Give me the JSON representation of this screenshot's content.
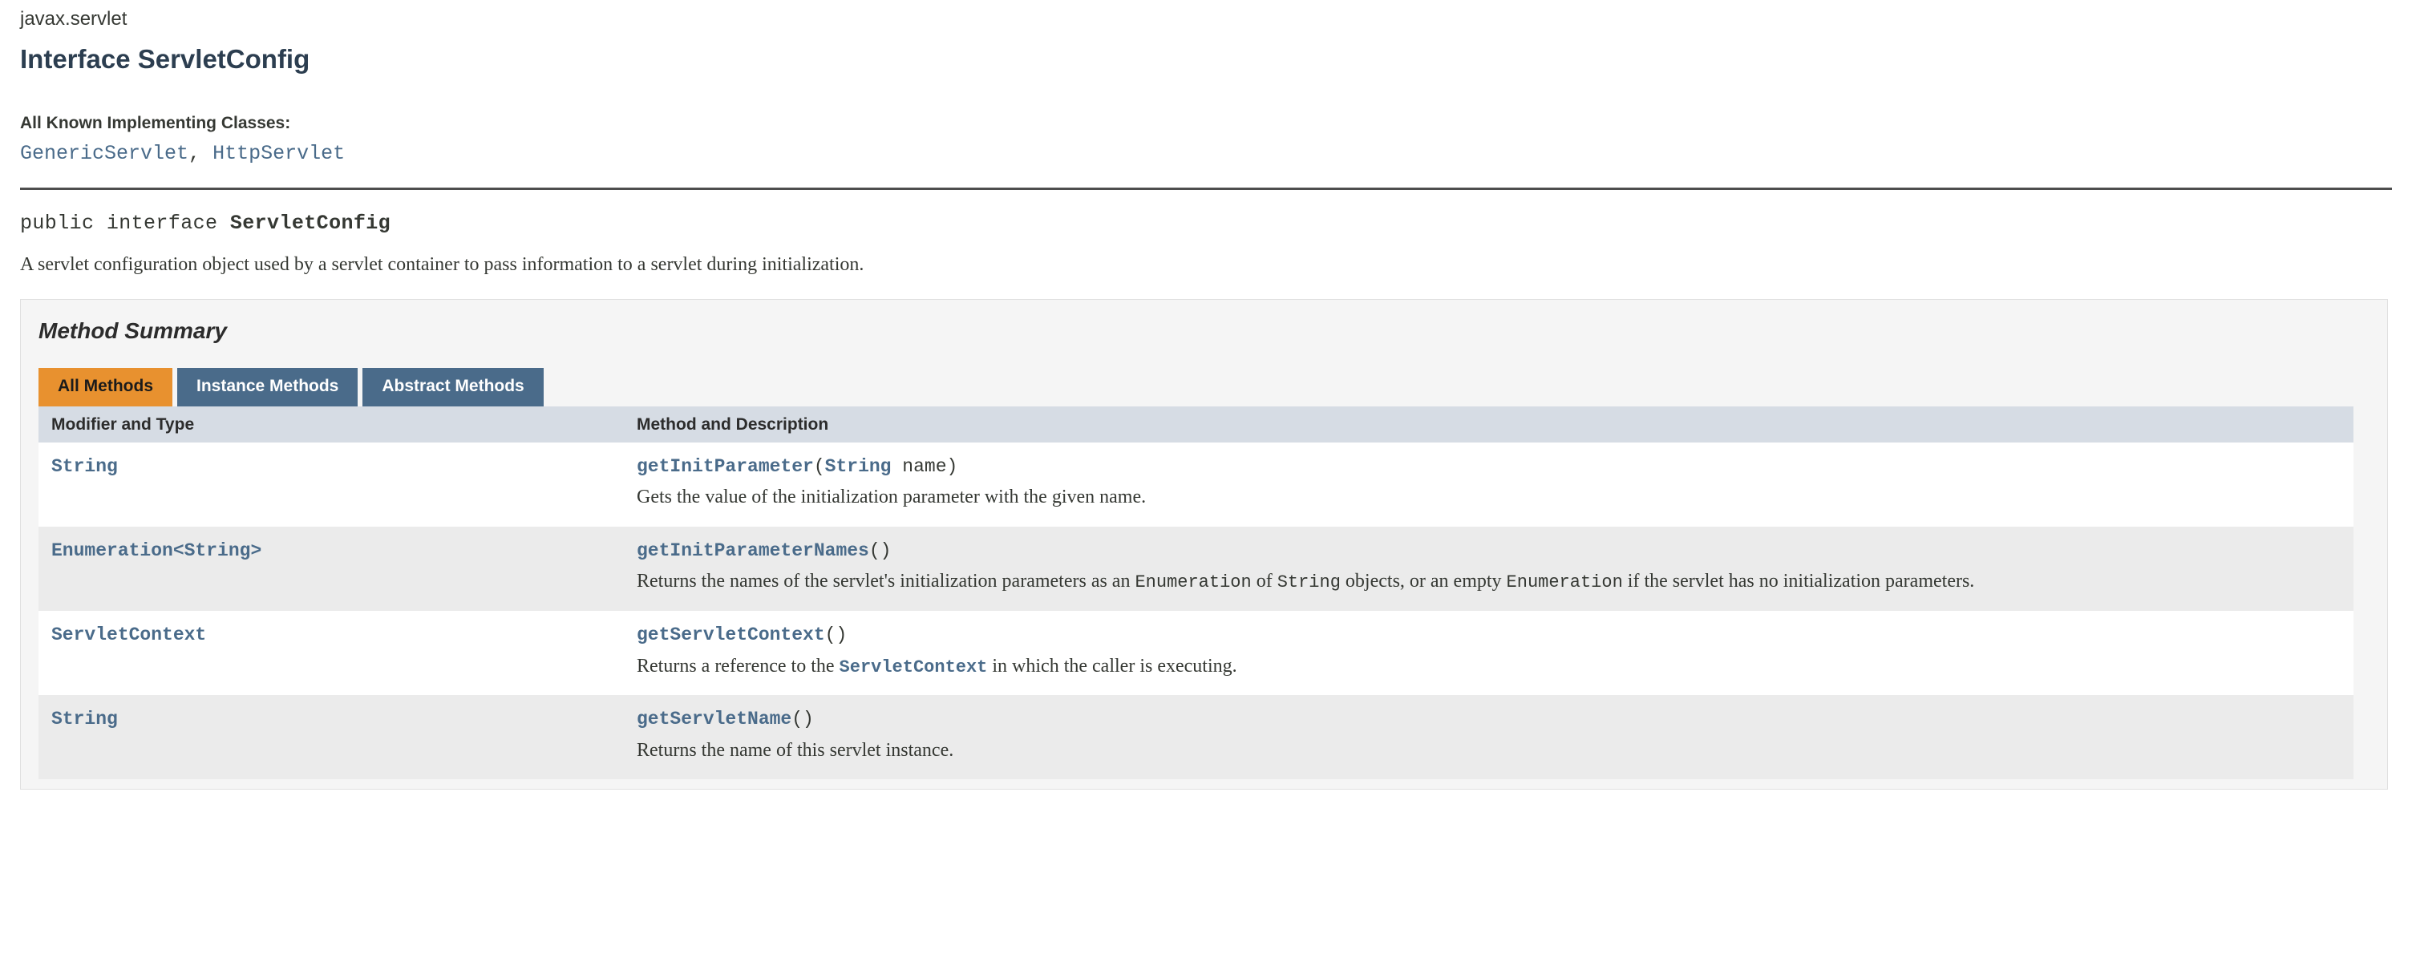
{
  "header": {
    "package": "javax.servlet",
    "title": "Interface ServletConfig"
  },
  "implementing": {
    "label": "All Known Implementing Classes:",
    "classes": [
      "GenericServlet",
      "HttpServlet"
    ],
    "separator": ", "
  },
  "declaration": {
    "modifiers": "public interface ",
    "name": "ServletConfig"
  },
  "class_description": "A servlet configuration object used by a servlet container to pass information to a servlet during initialization.",
  "method_summary": {
    "title": "Method Summary",
    "tabs": [
      {
        "label": "All Methods",
        "active": true
      },
      {
        "label": "Instance Methods",
        "active": false
      },
      {
        "label": "Abstract Methods",
        "active": false
      }
    ],
    "columns": {
      "first": "Modifier and Type",
      "last": "Method and Description"
    },
    "rows": [
      {
        "type": "String",
        "type_generic": "",
        "method_name": "getInitParameter",
        "signature_open": "(",
        "param_type": "String",
        "param_name": " name",
        "signature_close": ")",
        "description_1": "Gets the value of the initialization parameter with the given name.",
        "code_1": "",
        "description_2": "",
        "code_2": "",
        "description_3": "",
        "code_3": "",
        "description_4": ""
      },
      {
        "type": "Enumeration",
        "type_generic": "<String>",
        "method_name": "getInitParameterNames",
        "signature_open": "(",
        "param_type": "",
        "param_name": "",
        "signature_close": ")",
        "description_1": "Returns the names of the servlet's initialization parameters as an ",
        "code_1": "Enumeration",
        "description_2": " of ",
        "code_2": "String",
        "description_3": " objects, or an empty ",
        "code_3": "Enumeration",
        "description_4": " if the servlet has no initialization parameters."
      },
      {
        "type": "ServletContext",
        "type_generic": "",
        "method_name": "getServletContext",
        "signature_open": "(",
        "param_type": "",
        "param_name": "",
        "signature_close": ")",
        "description_1": "Returns a reference to the ",
        "code_1": "ServletContext",
        "code_1_link": true,
        "description_2": " in which the caller is executing.",
        "code_2": "",
        "description_3": "",
        "code_3": "",
        "description_4": ""
      },
      {
        "type": "String",
        "type_generic": "",
        "method_name": "getServletName",
        "signature_open": "(",
        "param_type": "",
        "param_name": "",
        "signature_close": ")",
        "description_1": "Returns the name of this servlet instance.",
        "code_1": "",
        "description_2": "",
        "code_2": "",
        "description_3": "",
        "code_3": "",
        "description_4": ""
      }
    ]
  },
  "colors": {
    "accent_orange": "#e8912f",
    "tab_blue": "#4a6b8a",
    "header_row": "#d6dce4",
    "alt_row": "#ebebeb",
    "link": "#4a6b8a",
    "heading": "#2c3e50"
  }
}
